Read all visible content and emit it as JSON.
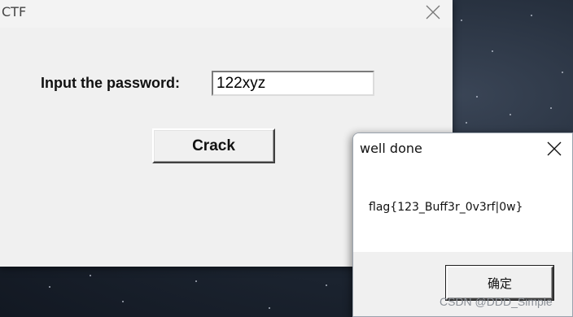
{
  "main_window": {
    "title": "CTF",
    "password_label": "Input the password:",
    "password_value": "122xyz",
    "crack_label": "Crack"
  },
  "message_box": {
    "title": "well done",
    "message": "flag{123_Buff3r_0v3rf|0w}",
    "ok_label": "确定"
  },
  "watermark": "CSDN @DDD_Simple",
  "icons": {
    "close": "close-icon"
  }
}
